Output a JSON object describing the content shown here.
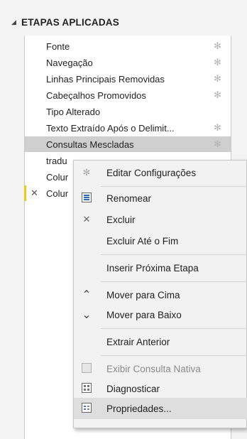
{
  "panel": {
    "collapse_glyph": "◢",
    "title": "ETAPAS APLICADAS"
  },
  "steps": [
    {
      "label": "Fonte",
      "gear": "✻"
    },
    {
      "label": "Navegação",
      "gear": "✻"
    },
    {
      "label": "Linhas Principais Removidas",
      "gear": "✻"
    },
    {
      "label": "Cabeçalhos Promovidos",
      "gear": "✻"
    },
    {
      "label": "Tipo Alterado",
      "gear": ""
    },
    {
      "label": "Texto Extraído Após o Delimit...",
      "gear": "✻"
    },
    {
      "label": "Consultas Mescladas",
      "gear": "✻"
    },
    {
      "label": "tradu",
      "gear": ""
    },
    {
      "label": "Colur",
      "gear": ""
    },
    {
      "label": "Colur",
      "gear": "",
      "x_glyph": "✕"
    }
  ],
  "context_menu": {
    "items": [
      {
        "label": "Editar Configurações",
        "icon": "gear-icon",
        "glyph": "✻"
      },
      {
        "label": "Renomear",
        "icon": "rename-icon"
      },
      {
        "label": "Excluir",
        "icon": "delete-x-icon",
        "glyph": "✕"
      },
      {
        "label": "Excluir Até o Fim"
      },
      {
        "label": "Inserir Próxima Etapa"
      },
      {
        "label": "Mover para Cima",
        "icon": "chevron-up-icon",
        "glyph": "⌃"
      },
      {
        "label": "Mover para Baixo",
        "icon": "chevron-down-icon",
        "glyph": "⌄"
      },
      {
        "label": "Extrair Anterior"
      },
      {
        "label": "Exibir Consulta Nativa",
        "icon": "native-query-icon",
        "disabled": true
      },
      {
        "label": "Diagnosticar",
        "icon": "diagnose-icon"
      },
      {
        "label": "Propriedades...",
        "icon": "properties-icon"
      }
    ]
  },
  "colors": {
    "accent_marker": "#f2c811",
    "selected_row": "#cfcfcf",
    "hover_row": "#dedede"
  }
}
